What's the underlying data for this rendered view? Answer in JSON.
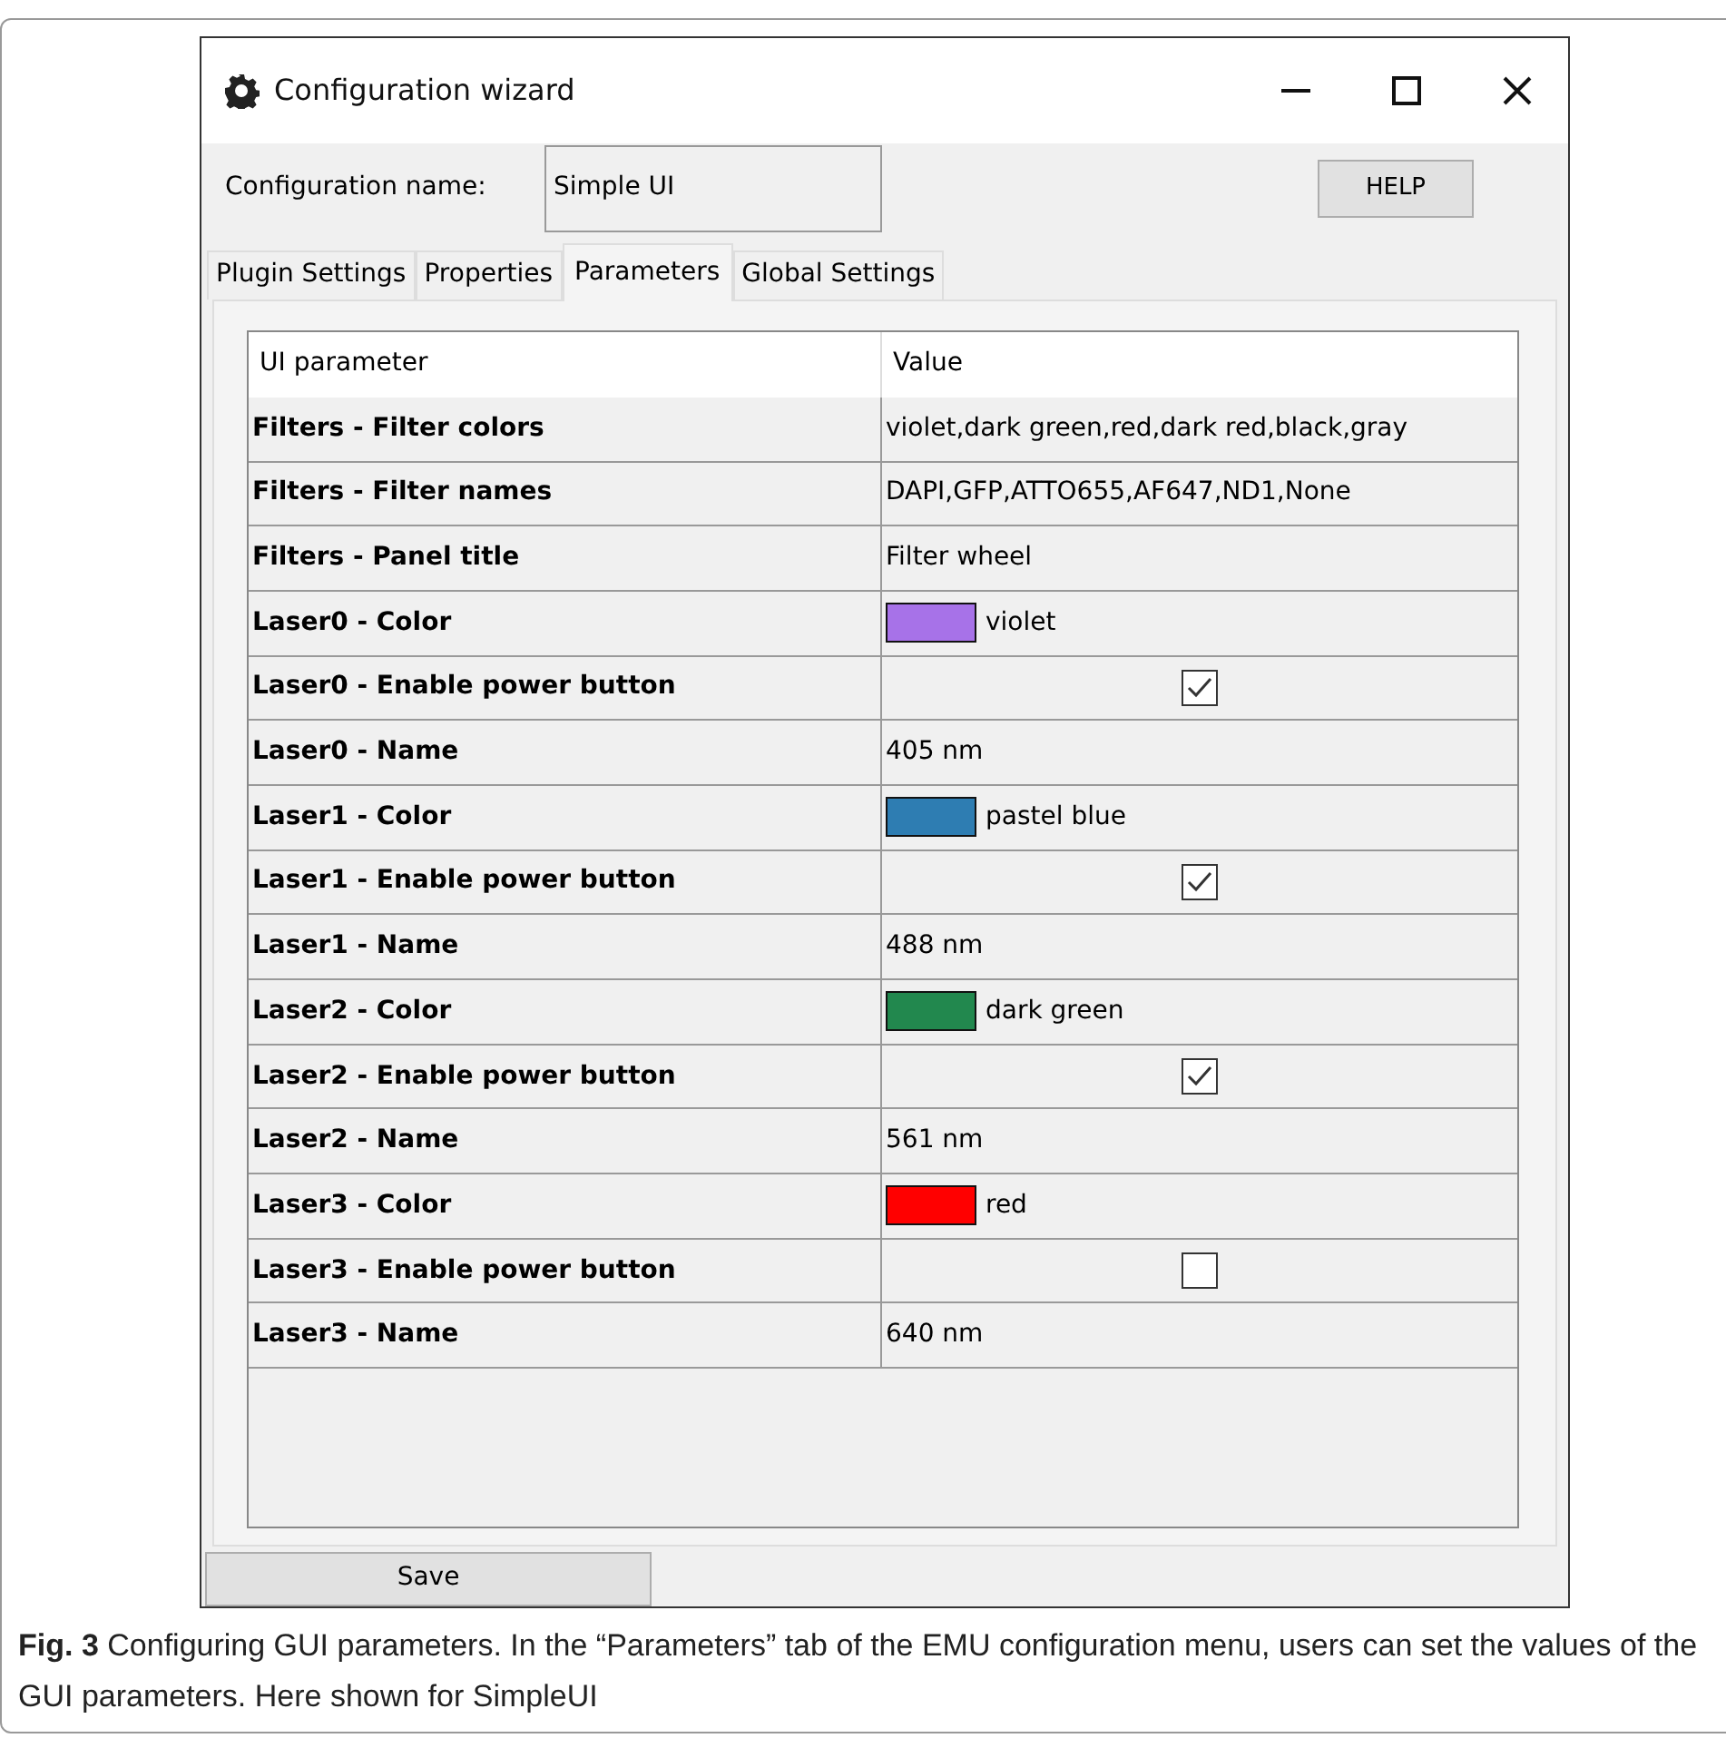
{
  "window": {
    "title": "Configuration wizard"
  },
  "configuration_name": {
    "label": "Configuration name:",
    "value": "Simple UI"
  },
  "help_button": "HELP",
  "tabs": [
    {
      "label": "Plugin Settings",
      "selected": false
    },
    {
      "label": "Properties",
      "selected": false
    },
    {
      "label": "Parameters",
      "selected": true
    },
    {
      "label": "Global Settings",
      "selected": false
    }
  ],
  "table": {
    "columns": [
      "UI parameter",
      "Value"
    ],
    "rows": [
      {
        "parameter": "Filters - Filter colors",
        "kind": "text",
        "value": "violet,dark green,red,dark red,black,gray"
      },
      {
        "parameter": "Filters - Filter names",
        "kind": "text",
        "value": "DAPI,GFP,ATTO655,AF647,ND1,None"
      },
      {
        "parameter": "Filters - Panel title",
        "kind": "text",
        "value": "Filter wheel"
      },
      {
        "parameter": "Laser0 - Color",
        "kind": "color",
        "value": "violet",
        "color": "#a772e8"
      },
      {
        "parameter": "Laser0 - Enable power button",
        "kind": "checkbox",
        "checked": true
      },
      {
        "parameter": "Laser0 - Name",
        "kind": "text",
        "value": "405 nm"
      },
      {
        "parameter": "Laser1 - Color",
        "kind": "color",
        "value": "pastel blue",
        "color": "#2e7db2"
      },
      {
        "parameter": "Laser1 - Enable power button",
        "kind": "checkbox",
        "checked": true
      },
      {
        "parameter": "Laser1 - Name",
        "kind": "text",
        "value": "488 nm"
      },
      {
        "parameter": "Laser2 - Color",
        "kind": "color",
        "value": "dark green",
        "color": "#22884e"
      },
      {
        "parameter": "Laser2 - Enable power button",
        "kind": "checkbox",
        "checked": true
      },
      {
        "parameter": "Laser2 - Name",
        "kind": "text",
        "value": "561 nm"
      },
      {
        "parameter": "Laser3 - Color",
        "kind": "color",
        "value": "red",
        "color": "#ff0000"
      },
      {
        "parameter": "Laser3 - Enable power button",
        "kind": "checkbox",
        "checked": false
      },
      {
        "parameter": "Laser3 - Name",
        "kind": "text",
        "value": "640 nm"
      }
    ]
  },
  "save_button": "Save",
  "caption": "**Fig. 3**  Configuring GUI parameters. In the “Parameters” tab of the EMU configuration menu, users can set the values of the GUI parameters. Here shown for SimpleUI"
}
